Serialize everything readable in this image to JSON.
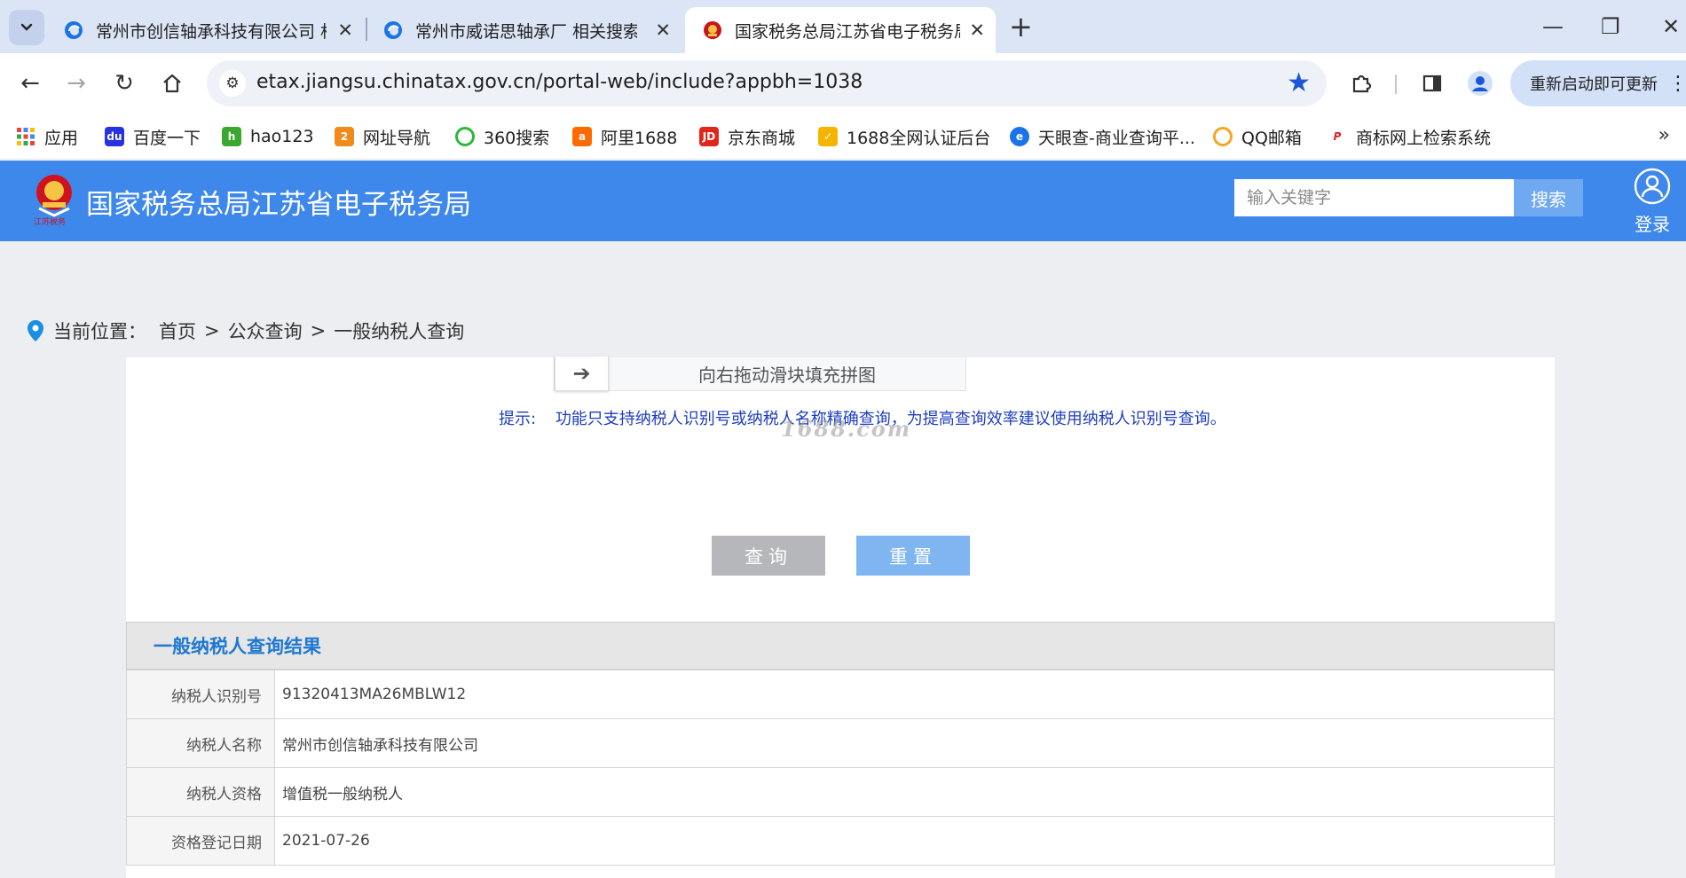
{
  "browser": {
    "tabs": [
      {
        "title": "常州市创信轴承科技有限公司 相关搜索",
        "close": "✕"
      },
      {
        "title": "常州市威诺思轴承厂 相关搜索结果",
        "close": "✕"
      },
      {
        "title": "国家税务总局江苏省电子税务局",
        "close": "✕"
      }
    ],
    "new_tab": "+",
    "window": {
      "minimize": "—",
      "restore": "❐",
      "close": "✕"
    },
    "url": "etax.jiangsu.chinatax.gov.cn/portal-web/include?appbh=1038",
    "update_label": "重新启动即可更新",
    "bookmarks": [
      "应用",
      "百度一下",
      "hao123",
      "网址导航",
      "360搜索",
      "阿里1688",
      "京东商城",
      "1688全网认证后台",
      "天眼查-商业查询平...",
      "QQ邮箱",
      "商标网上检索系统"
    ]
  },
  "site": {
    "logo_caption": "江苏税务",
    "title": "国家税务总局江苏省电子税务局",
    "search_placeholder": "输入关键字",
    "search_button": "搜索",
    "login": "登录"
  },
  "breadcrumb": {
    "label": "当前位置：",
    "items": [
      "首页",
      "公众查询",
      "一般纳税人查询"
    ],
    "separator": ">"
  },
  "query": {
    "slider_text": "向右拖动滑块填充拼图",
    "hint_label": "提示:",
    "hint_text": "功能只支持纳税人识别号或纳税人名称精确查询，为提高查询效率建议使用纳税人识别号查询。",
    "watermark": "1688.com",
    "query_button": "查询",
    "reset_button": "重置"
  },
  "result": {
    "title": "一般纳税人查询结果",
    "rows": [
      {
        "key": "纳税人识别号",
        "value": "91320413MA26MBLW12"
      },
      {
        "key": "纳税人名称",
        "value": "常州市创信轴承科技有限公司"
      },
      {
        "key": "纳税人资格",
        "value": "增值税一般纳税人"
      },
      {
        "key": "资格登记日期",
        "value": "2021-07-26"
      }
    ]
  },
  "colors": {
    "header_blue": "#3e88ec",
    "result_title": "#1e78d2",
    "hint": "#1f3fbf"
  }
}
